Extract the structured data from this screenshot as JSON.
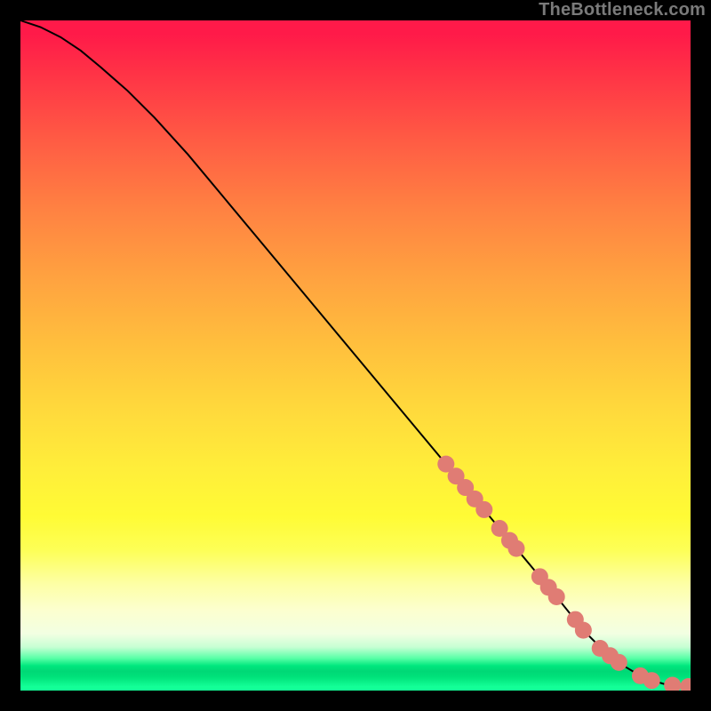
{
  "watermark": "TheBottleneck.com",
  "colors": {
    "curve": "#000000",
    "dot_fill": "#e07c74",
    "dot_stroke": "#d96e65"
  },
  "chart_data": {
    "type": "line",
    "title": "",
    "xlabel": "",
    "ylabel": "",
    "xlim": [
      0,
      100
    ],
    "ylim": [
      0,
      100
    ],
    "series": [
      {
        "name": "curve",
        "x": [
          0,
          3,
          6,
          9,
          12,
          16,
          20,
          25,
          30,
          35,
          40,
          45,
          50,
          55,
          60,
          65,
          70,
          75,
          80,
          82,
          84,
          86,
          88,
          90,
          92,
          94,
          96,
          98,
          100
        ],
        "y": [
          100,
          99,
          97.5,
          95.5,
          93,
          89.5,
          85.5,
          80,
          74,
          68,
          62,
          56,
          50,
          44,
          38,
          32,
          26,
          20,
          14,
          11.5,
          9,
          7,
          5.2,
          3.7,
          2.5,
          1.6,
          1.0,
          0.7,
          0.6
        ]
      }
    ],
    "markers": [
      {
        "x": 63.5,
        "y": 33.8
      },
      {
        "x": 65.0,
        "y": 32.0
      },
      {
        "x": 66.4,
        "y": 30.3
      },
      {
        "x": 67.8,
        "y": 28.6
      },
      {
        "x": 69.2,
        "y": 27.0
      },
      {
        "x": 71.5,
        "y": 24.2
      },
      {
        "x": 73.0,
        "y": 22.4
      },
      {
        "x": 74.0,
        "y": 21.2
      },
      {
        "x": 77.5,
        "y": 17.0
      },
      {
        "x": 78.8,
        "y": 15.4
      },
      {
        "x": 80.0,
        "y": 14.0
      },
      {
        "x": 82.8,
        "y": 10.6
      },
      {
        "x": 84.0,
        "y": 9.0
      },
      {
        "x": 86.5,
        "y": 6.3
      },
      {
        "x": 88.0,
        "y": 5.2
      },
      {
        "x": 89.3,
        "y": 4.2
      },
      {
        "x": 92.5,
        "y": 2.2
      },
      {
        "x": 94.2,
        "y": 1.5
      },
      {
        "x": 97.3,
        "y": 0.8
      },
      {
        "x": 99.7,
        "y": 0.6
      }
    ],
    "marker_radius": 9.5
  }
}
